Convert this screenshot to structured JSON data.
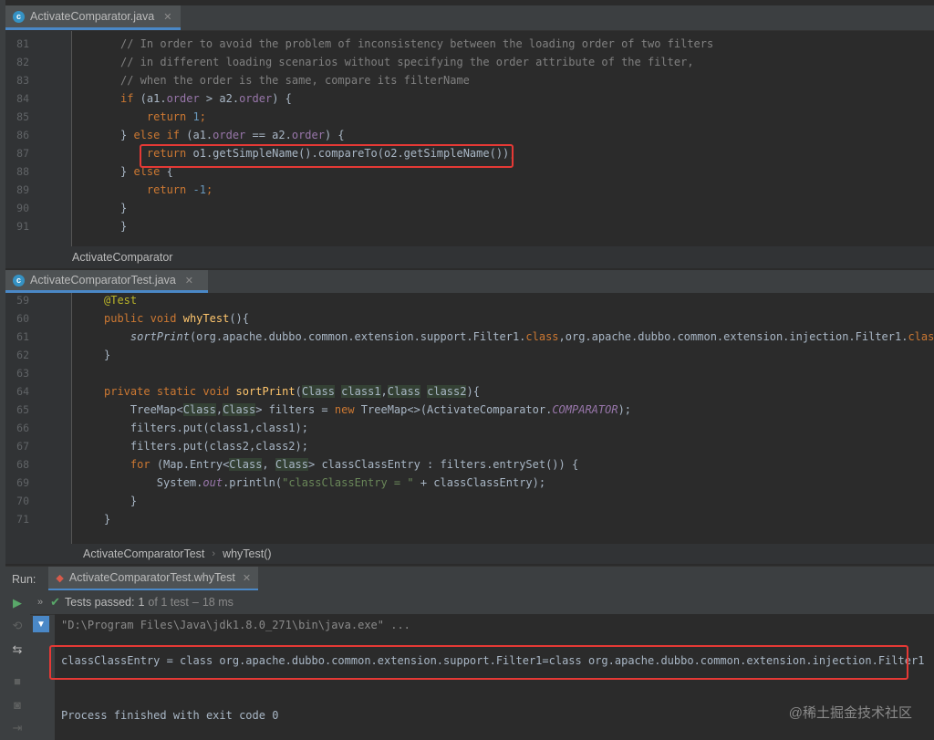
{
  "top_tab": {
    "label": "ActivateComparator.java",
    "icon": "class-icon"
  },
  "top_editor": {
    "lines": [
      {
        "num": "81",
        "segments": [
          {
            "t": "// In order to avoid the problem of inconsistency between the loading order of two filters",
            "c": "cm"
          }
        ]
      },
      {
        "num": "82",
        "segments": [
          {
            "t": "// in different loading scenarios without specifying the order attribute of the filter,",
            "c": "cm"
          }
        ]
      },
      {
        "num": "83",
        "segments": [
          {
            "t": "// when the order is the same, compare its filterName",
            "c": "cm"
          }
        ]
      },
      {
        "num": "84",
        "segments": [
          {
            "t": "if",
            "c": "kw"
          },
          {
            "t": " (a1.",
            "c": ""
          },
          {
            "t": "order",
            "c": "fld"
          },
          {
            "t": " > a2.",
            "c": ""
          },
          {
            "t": "order",
            "c": "fld"
          },
          {
            "t": ") {",
            "c": ""
          }
        ]
      },
      {
        "num": "85",
        "segments": [
          {
            "t": "    ",
            "c": ""
          },
          {
            "t": "return",
            "c": "kw"
          },
          {
            "t": " ",
            "c": ""
          },
          {
            "t": "1",
            "c": "num"
          },
          {
            "t": ";",
            "c": "kw"
          }
        ]
      },
      {
        "num": "86",
        "segments": [
          {
            "t": "} ",
            "c": ""
          },
          {
            "t": "else if",
            "c": "kw"
          },
          {
            "t": " (a1.",
            "c": ""
          },
          {
            "t": "order",
            "c": "fld"
          },
          {
            "t": " == a2.",
            "c": ""
          },
          {
            "t": "order",
            "c": "fld"
          },
          {
            "t": ") {",
            "c": ""
          }
        ]
      },
      {
        "num": "87",
        "segments": [
          {
            "t": "    ",
            "c": ""
          },
          {
            "t": "return",
            "c": "kw"
          },
          {
            "t": " o1.getSimpleName().compareTo(o2.getSimpleName())",
            "c": ""
          },
          {
            "t": ";",
            "c": "kw"
          }
        ]
      },
      {
        "num": "88",
        "segments": [
          {
            "t": "} ",
            "c": ""
          },
          {
            "t": "else",
            "c": "kw"
          },
          {
            "t": " {",
            "c": ""
          }
        ]
      },
      {
        "num": "89",
        "segments": [
          {
            "t": "    ",
            "c": ""
          },
          {
            "t": "return",
            "c": "kw"
          },
          {
            "t": " ",
            "c": ""
          },
          {
            "t": "-1",
            "c": "num"
          },
          {
            "t": ";",
            "c": "kw"
          }
        ]
      },
      {
        "num": "90",
        "segments": [
          {
            "t": "}",
            "c": ""
          }
        ]
      },
      {
        "num": "91",
        "segments": [
          {
            "t": "}",
            "c": ""
          }
        ]
      }
    ]
  },
  "top_breadcrumb": {
    "items": [
      "ActivateComparator"
    ]
  },
  "bottom_tab": {
    "label": "ActivateComparatorTest.java",
    "icon": "class-icon"
  },
  "bottom_editor": {
    "lines": [
      {
        "num": "59",
        "segments": [
          {
            "t": "@Test",
            "c": "ann"
          }
        ]
      },
      {
        "num": "60",
        "segments": [
          {
            "t": "public",
            "c": "kw"
          },
          {
            "t": " ",
            "c": ""
          },
          {
            "t": "void",
            "c": "kw"
          },
          {
            "t": " ",
            "c": ""
          },
          {
            "t": "whyTest",
            "c": "fn"
          },
          {
            "t": "(){",
            "c": ""
          }
        ]
      },
      {
        "num": "61",
        "segments": [
          {
            "t": "    ",
            "c": ""
          },
          {
            "t": "sortPrint",
            "c": "ital"
          },
          {
            "t": "(org.apache.dubbo.common.extension.support.Filter1.",
            "c": ""
          },
          {
            "t": "class",
            "c": "kw"
          },
          {
            "t": ",org.apache.dubbo.common.extension.injection.Filter1.",
            "c": ""
          },
          {
            "t": "class",
            "c": "kw"
          },
          {
            "t": ");",
            "c": ""
          }
        ]
      },
      {
        "num": "62",
        "segments": [
          {
            "t": "}",
            "c": ""
          }
        ]
      },
      {
        "num": "63",
        "segments": []
      },
      {
        "num": "64",
        "segments": [
          {
            "t": "private",
            "c": "kw"
          },
          {
            "t": " ",
            "c": ""
          },
          {
            "t": "static",
            "c": "kw"
          },
          {
            "t": " ",
            "c": ""
          },
          {
            "t": "void",
            "c": "kw"
          },
          {
            "t": " ",
            "c": ""
          },
          {
            "t": "sortPrint",
            "c": "fn"
          },
          {
            "t": "(",
            "c": ""
          },
          {
            "t": "Class",
            "c": "hl"
          },
          {
            "t": " ",
            "c": ""
          },
          {
            "t": "class1",
            "c": "hl"
          },
          {
            "t": ",",
            "c": ""
          },
          {
            "t": "Class",
            "c": "hl"
          },
          {
            "t": " ",
            "c": ""
          },
          {
            "t": "class2",
            "c": "hl"
          },
          {
            "t": "){",
            "c": ""
          }
        ]
      },
      {
        "num": "65",
        "segments": [
          {
            "t": "    TreeMap<",
            "c": ""
          },
          {
            "t": "Class",
            "c": "hl"
          },
          {
            "t": ",",
            "c": ""
          },
          {
            "t": "Class",
            "c": "hl"
          },
          {
            "t": "> filters = ",
            "c": ""
          },
          {
            "t": "new",
            "c": "kw"
          },
          {
            "t": " TreeMap<>(ActivateComparator.",
            "c": ""
          },
          {
            "t": "COMPARATOR",
            "c": "fld ital"
          },
          {
            "t": ");",
            "c": ""
          }
        ]
      },
      {
        "num": "66",
        "segments": [
          {
            "t": "    filters.put(class1,class1);",
            "c": ""
          }
        ]
      },
      {
        "num": "67",
        "segments": [
          {
            "t": "    filters.put(class2,class2);",
            "c": ""
          }
        ]
      },
      {
        "num": "68",
        "segments": [
          {
            "t": "    ",
            "c": ""
          },
          {
            "t": "for",
            "c": "kw"
          },
          {
            "t": " (Map.Entry<",
            "c": ""
          },
          {
            "t": "Class",
            "c": "hl"
          },
          {
            "t": ", ",
            "c": ""
          },
          {
            "t": "Class",
            "c": "hl"
          },
          {
            "t": "> classClassEntry : filters.entrySet()) {",
            "c": ""
          }
        ]
      },
      {
        "num": "69",
        "segments": [
          {
            "t": "        System.",
            "c": ""
          },
          {
            "t": "out",
            "c": "fld ital"
          },
          {
            "t": ".println(",
            "c": ""
          },
          {
            "t": "\"classClassEntry = \"",
            "c": "str"
          },
          {
            "t": " + classClassEntry);",
            "c": ""
          }
        ]
      },
      {
        "num": "70",
        "segments": [
          {
            "t": "    }",
            "c": ""
          }
        ]
      },
      {
        "num": "71",
        "segments": [
          {
            "t": "}",
            "c": ""
          }
        ]
      }
    ]
  },
  "bottom_breadcrumb": {
    "items": [
      "ActivateComparatorTest",
      "whyTest()"
    ]
  },
  "run_panel": {
    "label": "Run:",
    "tab_label": "ActivateComparatorTest.whyTest",
    "tests_passed_label": "Tests passed:",
    "tests_passed_count": "1",
    "tests_total": "of 1 test",
    "tests_time": "18 ms",
    "console_lines": [
      "\"D:\\Program Files\\Java\\jdk1.8.0_271\\bin\\java.exe\" ...",
      "classClassEntry = class org.apache.dubbo.common.extension.support.Filter1=class org.apache.dubbo.common.extension.injection.Filter1",
      "Process finished with exit code 0"
    ]
  },
  "watermark": "@稀土掘金技术社区",
  "colors": {
    "keyword": "#cc7832",
    "comment": "#808080",
    "number": "#6897bb",
    "field": "#9876aa",
    "function": "#ffc66d",
    "string": "#6a8759",
    "annotation": "#bbb529",
    "highlight_box": "#e53935",
    "pass_green": "#59a869"
  }
}
